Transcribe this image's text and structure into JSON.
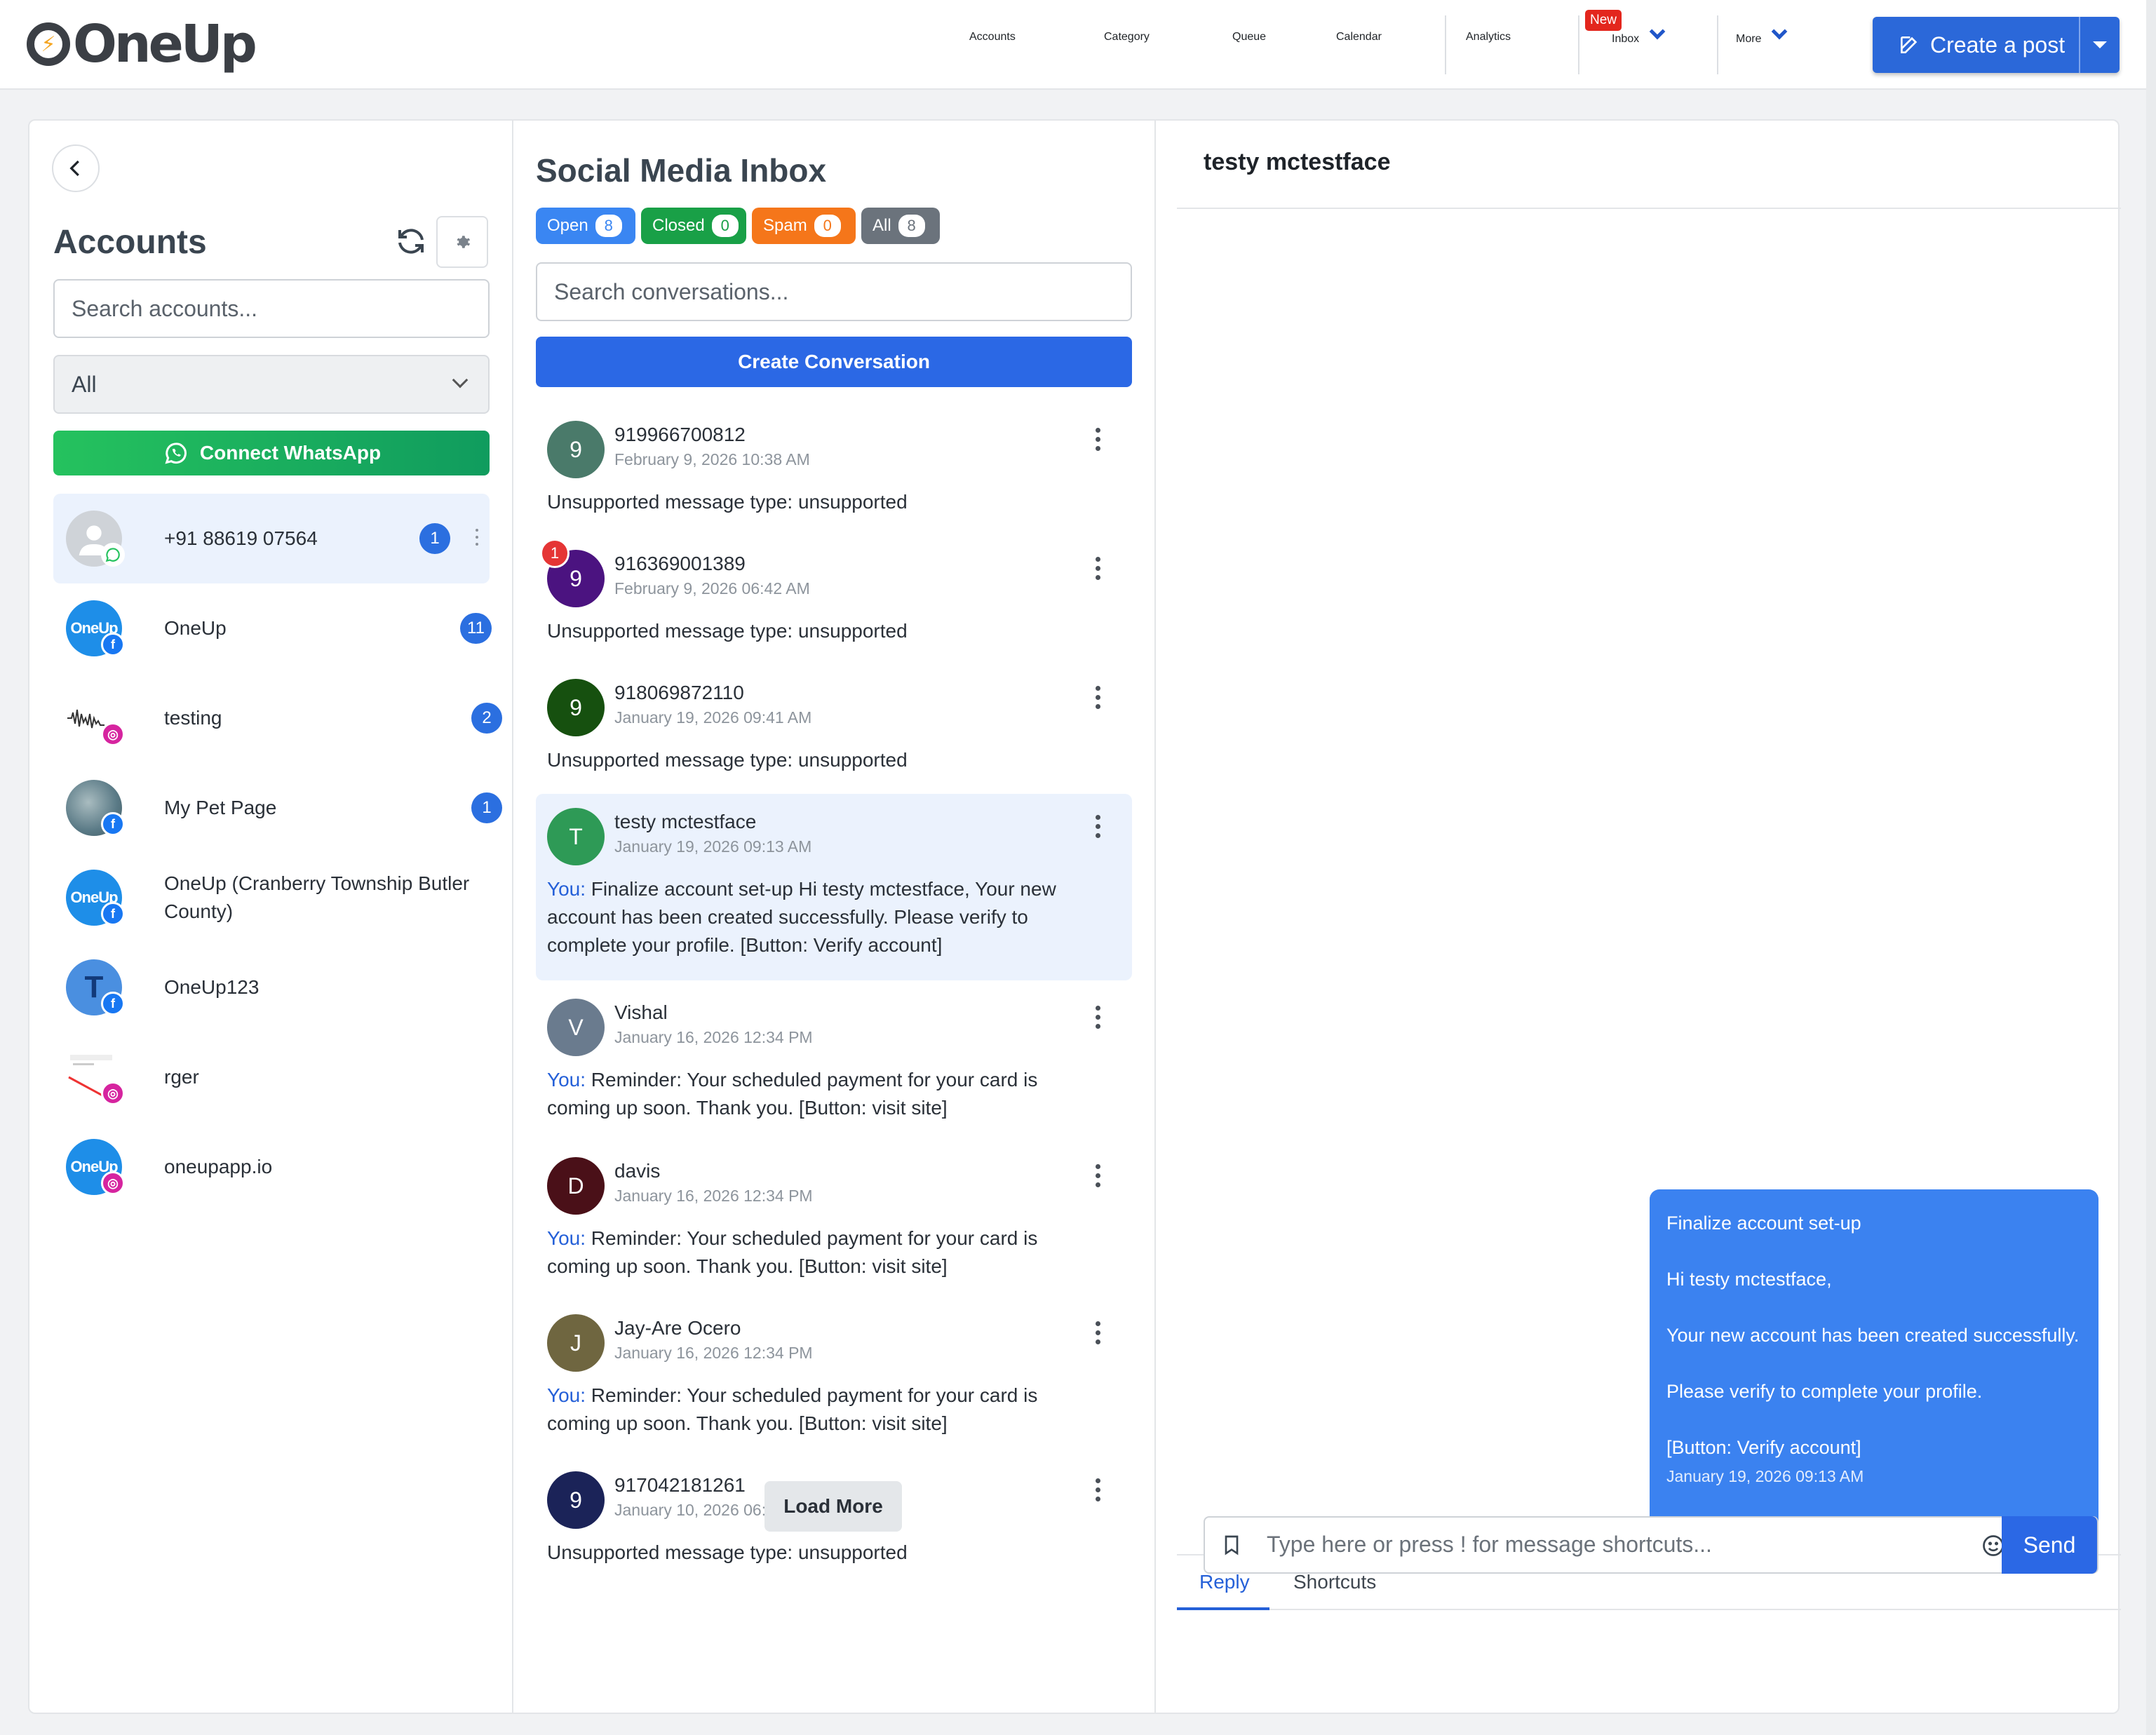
{
  "brand": {
    "logo_text": "OneUp"
  },
  "nav": {
    "items": [
      "Accounts",
      "Category",
      "Queue",
      "Calendar",
      "Analytics"
    ],
    "inbox_label": "Inbox",
    "new_badge": "New",
    "more_label": "More",
    "create_post_label": "Create a post"
  },
  "accounts": {
    "title": "Accounts",
    "search_placeholder": "Search accounts...",
    "filter_value": "All",
    "connect_whatsapp": "Connect WhatsApp",
    "list": [
      {
        "name": "+91 88619 07564",
        "count": "1",
        "network": "whatsapp",
        "avatar_color": "#cfd3d8",
        "avatar_text": ""
      },
      {
        "name": "OneUp",
        "count": "11",
        "network": "facebook",
        "avatar_color": "#1e8ee8",
        "avatar_text": "OneUp"
      },
      {
        "name": "testing",
        "count": "2",
        "network": "instagram",
        "avatar_color": "#ffffff",
        "avatar_text": ""
      },
      {
        "name": "My Pet Page",
        "count": "1",
        "network": "facebook",
        "avatar_color": "#6d8a94",
        "avatar_text": ""
      },
      {
        "name": "OneUp (Cranberry Township Butler County)",
        "count": "",
        "network": "facebook",
        "avatar_color": "#1e8ee8",
        "avatar_text": "OneUp"
      },
      {
        "name": "OneUp123",
        "count": "",
        "network": "facebook",
        "avatar_color": "#4a8fe0",
        "avatar_text": "T"
      },
      {
        "name": "rger",
        "count": "",
        "network": "instagram",
        "avatar_color": "#ffffff",
        "avatar_text": ""
      },
      {
        "name": "oneupapp.io",
        "count": "",
        "network": "instagram",
        "avatar_color": "#1e8ee8",
        "avatar_text": "OneUp"
      }
    ]
  },
  "inbox": {
    "title": "Social Media Inbox",
    "filters": [
      {
        "label": "Open",
        "count": "8",
        "color": "#3a86f2"
      },
      {
        "label": "Closed",
        "count": "0",
        "color": "#19a047"
      },
      {
        "label": "Spam",
        "count": "0",
        "color": "#f5761a"
      },
      {
        "label": "All",
        "count": "8",
        "color": "#6b737c"
      }
    ],
    "search_placeholder": "Search conversations...",
    "create_conversation": "Create Conversation",
    "load_more": "Load More",
    "you_prefix": "You:",
    "conversations": [
      {
        "initial": "9",
        "name": "919966700812",
        "date": "February 9, 2026 10:38 AM",
        "you": false,
        "message": "Unsupported message type: unsupported",
        "avatar_color": "#4a7a6a",
        "unread": ""
      },
      {
        "initial": "9",
        "name": "916369001389",
        "date": "February 9, 2026 06:42 AM",
        "you": false,
        "message": "Unsupported message type: unsupported",
        "avatar_color": "#4b1380",
        "unread": "1"
      },
      {
        "initial": "9",
        "name": "918069872110",
        "date": "January 19, 2026 09:41 AM",
        "you": false,
        "message": "Unsupported message type: unsupported",
        "avatar_color": "#16500f",
        "unread": ""
      },
      {
        "initial": "T",
        "name": "testy mctestface",
        "date": "January 19, 2026 09:13 AM",
        "you": true,
        "message": " Finalize account set-up Hi testy mctestface, Your new account has been created successfully. Please verify to complete your profile. [Button: Verify account]",
        "avatar_color": "#2e9a56",
        "unread": ""
      },
      {
        "initial": "V",
        "name": "Vishal",
        "date": "January 16, 2026 12:34 PM",
        "you": true,
        "message": " Reminder: Your scheduled payment for your card is coming up soon. Thank you. [Button: visit site]",
        "avatar_color": "#6a7b8e",
        "unread": ""
      },
      {
        "initial": "D",
        "name": "davis",
        "date": "January 16, 2026 12:34 PM",
        "you": true,
        "message": " Reminder: Your scheduled payment for your card is coming up soon. Thank you. [Button: visit site]",
        "avatar_color": "#4a1018",
        "unread": ""
      },
      {
        "initial": "J",
        "name": "Jay-Are Ocero",
        "date": "January 16, 2026 12:34 PM",
        "you": true,
        "message": " Reminder: Your scheduled payment for your card is coming up soon. Thank you. [Button: visit site]",
        "avatar_color": "#6f6640",
        "unread": ""
      },
      {
        "initial": "9",
        "name": "917042181261",
        "date": "January 10, 2026 06:39 AM",
        "you": false,
        "message": "Unsupported message type: unsupported",
        "avatar_color": "#1b2358",
        "unread": ""
      }
    ]
  },
  "chat": {
    "title": "testy mctestface",
    "bubble": {
      "lines": [
        "Finalize account set-up",
        "Hi testy mctestface,",
        "Your new account has been created successfully.",
        "Please verify to complete your profile.",
        "[Button: Verify account]"
      ],
      "date": "January 19, 2026 09:13 AM"
    },
    "tabs": {
      "reply": "Reply",
      "shortcuts": "Shortcuts"
    },
    "composer_placeholder": "Type here or press ! for message shortcuts...",
    "send_label": "Send"
  },
  "colors": {
    "primary": "#2b68e5",
    "whatsapp": "#25c25e",
    "facebook": "#1877f2",
    "unread": "#e53535"
  }
}
